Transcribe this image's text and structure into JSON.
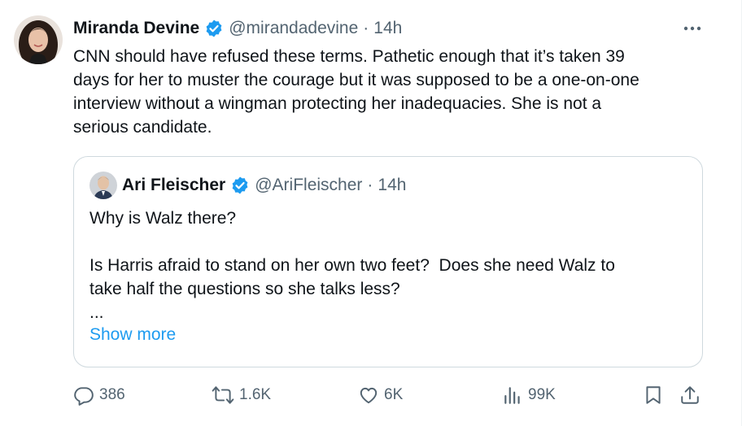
{
  "post": {
    "author_name": "Miranda Devine",
    "author_handle": "@mirandadevine",
    "separator": "·",
    "time": "14h",
    "text": "CNN should have refused these terms. Pathetic enough that it’s taken 39\ndays for her to muster the courage but it was supposed to be a one-on-one\ninterview without a wingman protecting her inadequacies. She is not a\nserious candidate."
  },
  "quote": {
    "author_name": "Ari Fleischer",
    "author_handle": "@AriFleischer",
    "separator": "·",
    "time": "14h",
    "text": "Why is Walz there?\n\nIs Harris afraid to stand on her own two feet?  Does she need Walz to\ntake half the questions so she talks less?\n...",
    "show_more": "Show more"
  },
  "actions": {
    "replies": "386",
    "reposts": "1.6K",
    "likes": "6K",
    "views": "99K"
  },
  "colors": {
    "accent": "#1d9bf0",
    "text": "#0f1419",
    "muted": "#536471",
    "border": "#cfd9de"
  }
}
